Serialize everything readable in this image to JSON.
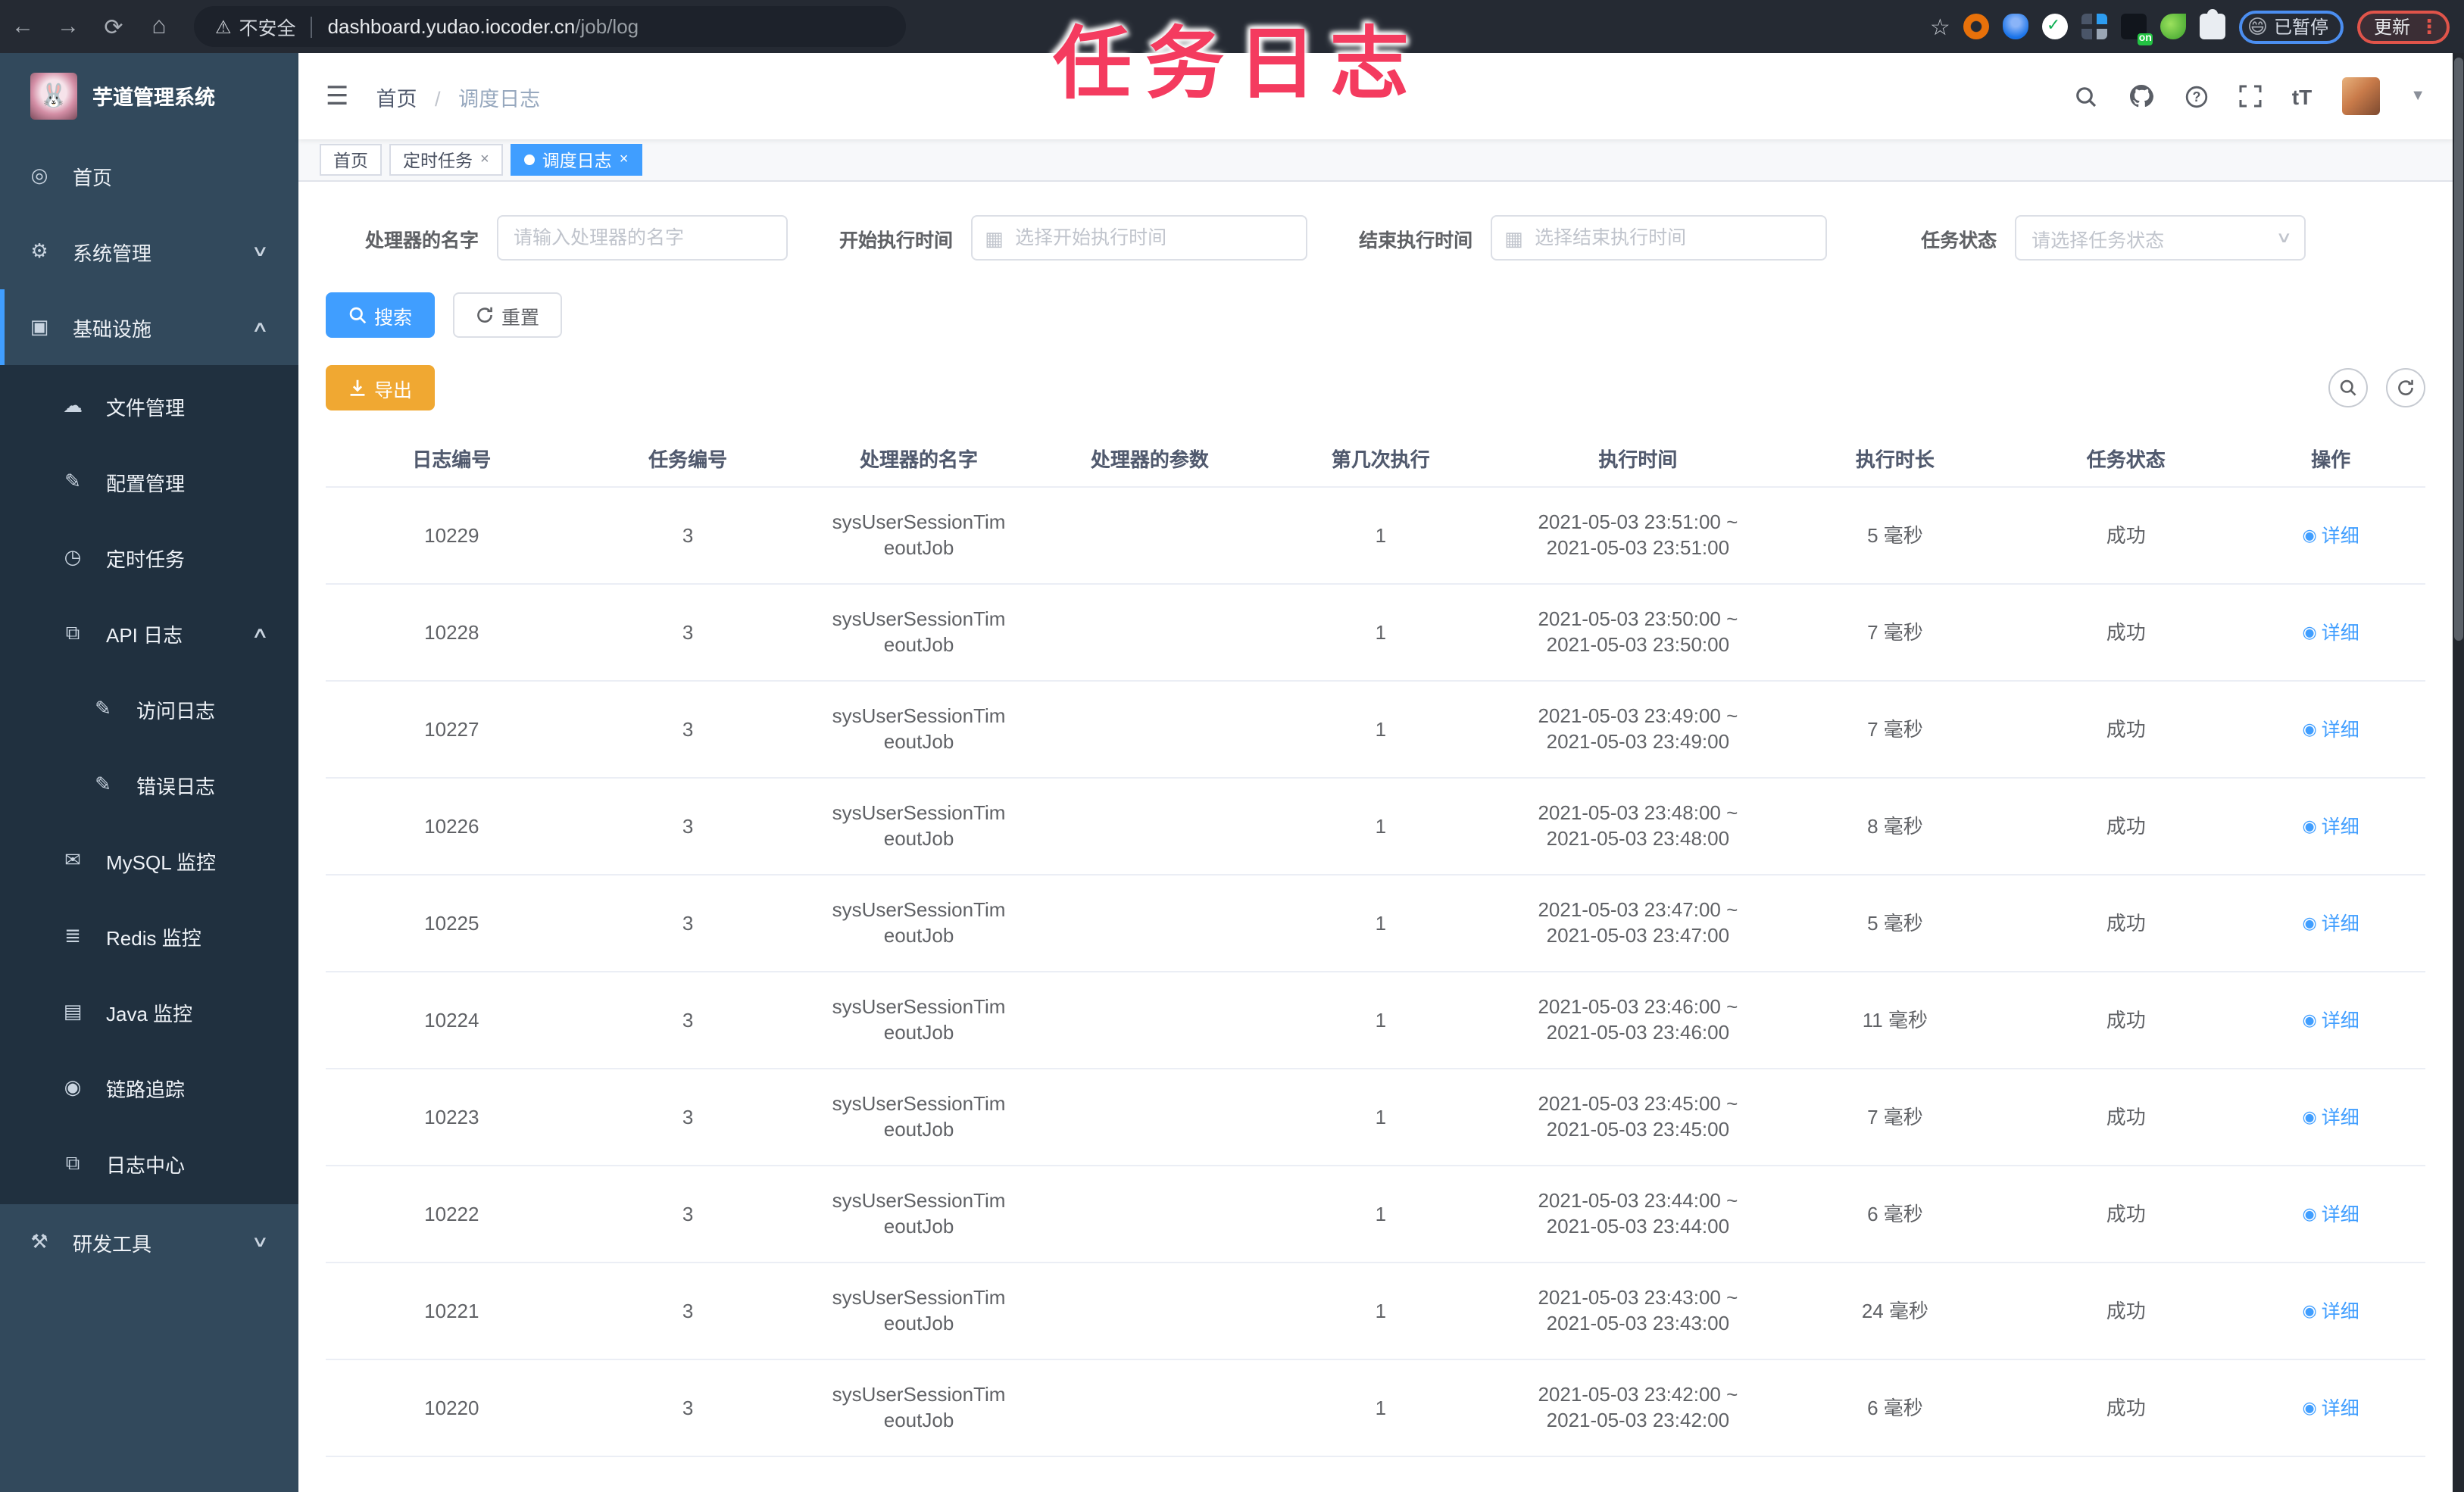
{
  "annotation": {
    "text": "任务日志"
  },
  "browser": {
    "not_secure": "不安全",
    "url_host": "dashboard.yudao.iocoder.cn",
    "url_path": "/job/log",
    "on_badge": "on",
    "paused_label": "已暂停",
    "paused_emoji": "😄",
    "update_label": "更新",
    "kebab": "⋮"
  },
  "sidebar": {
    "title": "芋道管理系统",
    "logo_emoji": "🐰",
    "items": [
      {
        "label": "首页"
      },
      {
        "label": "系统管理"
      },
      {
        "label": "基础设施"
      },
      {
        "label": "文件管理"
      },
      {
        "label": "配置管理"
      },
      {
        "label": "定时任务"
      },
      {
        "label": "API 日志"
      },
      {
        "label": "访问日志"
      },
      {
        "label": "错误日志"
      },
      {
        "label": "MySQL 监控"
      },
      {
        "label": "Redis 监控"
      },
      {
        "label": "Java 监控"
      },
      {
        "label": "链路追踪"
      },
      {
        "label": "日志中心"
      },
      {
        "label": "研发工具"
      }
    ]
  },
  "header": {
    "breadcrumb_home": "首页",
    "breadcrumb_sep": "/",
    "breadcrumb_current": "调度日志"
  },
  "tabs": [
    {
      "label": "首页"
    },
    {
      "label": "定时任务",
      "close": "×"
    },
    {
      "label": "调度日志",
      "close": "×"
    }
  ],
  "filters": {
    "handler_label": "处理器的名字",
    "handler_placeholder": "请输入处理器的名字",
    "begin_label": "开始执行时间",
    "begin_placeholder": "选择开始执行时间",
    "end_label": "结束执行时间",
    "end_placeholder": "选择结束执行时间",
    "status_label": "任务状态",
    "status_placeholder": "请选择任务状态"
  },
  "actions": {
    "search": "搜索",
    "reset": "重置",
    "export": "导出"
  },
  "table": {
    "headers": [
      "日志编号",
      "任务编号",
      "处理器的名字",
      "处理器的参数",
      "第几次执行",
      "执行时间",
      "执行时长",
      "任务状态",
      "操作"
    ],
    "action_label": "详细",
    "rows": [
      {
        "id": "10229",
        "job": "3",
        "handler1": "sysUserSessionTim",
        "handler2": "eoutJob",
        "param": "",
        "count": "1",
        "time1": "2021-05-03 23:51:00 ~",
        "time2": "2021-05-03 23:51:00",
        "duration": "5 毫秒",
        "status": "成功"
      },
      {
        "id": "10228",
        "job": "3",
        "handler1": "sysUserSessionTim",
        "handler2": "eoutJob",
        "param": "",
        "count": "1",
        "time1": "2021-05-03 23:50:00 ~",
        "time2": "2021-05-03 23:50:00",
        "duration": "7 毫秒",
        "status": "成功"
      },
      {
        "id": "10227",
        "job": "3",
        "handler1": "sysUserSessionTim",
        "handler2": "eoutJob",
        "param": "",
        "count": "1",
        "time1": "2021-05-03 23:49:00 ~",
        "time2": "2021-05-03 23:49:00",
        "duration": "7 毫秒",
        "status": "成功"
      },
      {
        "id": "10226",
        "job": "3",
        "handler1": "sysUserSessionTim",
        "handler2": "eoutJob",
        "param": "",
        "count": "1",
        "time1": "2021-05-03 23:48:00 ~",
        "time2": "2021-05-03 23:48:00",
        "duration": "8 毫秒",
        "status": "成功"
      },
      {
        "id": "10225",
        "job": "3",
        "handler1": "sysUserSessionTim",
        "handler2": "eoutJob",
        "param": "",
        "count": "1",
        "time1": "2021-05-03 23:47:00 ~",
        "time2": "2021-05-03 23:47:00",
        "duration": "5 毫秒",
        "status": "成功"
      },
      {
        "id": "10224",
        "job": "3",
        "handler1": "sysUserSessionTim",
        "handler2": "eoutJob",
        "param": "",
        "count": "1",
        "time1": "2021-05-03 23:46:00 ~",
        "time2": "2021-05-03 23:46:00",
        "duration": "11 毫秒",
        "status": "成功"
      },
      {
        "id": "10223",
        "job": "3",
        "handler1": "sysUserSessionTim",
        "handler2": "eoutJob",
        "param": "",
        "count": "1",
        "time1": "2021-05-03 23:45:00 ~",
        "time2": "2021-05-03 23:45:00",
        "duration": "7 毫秒",
        "status": "成功"
      },
      {
        "id": "10222",
        "job": "3",
        "handler1": "sysUserSessionTim",
        "handler2": "eoutJob",
        "param": "",
        "count": "1",
        "time1": "2021-05-03 23:44:00 ~",
        "time2": "2021-05-03 23:44:00",
        "duration": "6 毫秒",
        "status": "成功"
      },
      {
        "id": "10221",
        "job": "3",
        "handler1": "sysUserSessionTim",
        "handler2": "eoutJob",
        "param": "",
        "count": "1",
        "time1": "2021-05-03 23:43:00 ~",
        "time2": "2021-05-03 23:43:00",
        "duration": "24 毫秒",
        "status": "成功"
      },
      {
        "id": "10220",
        "job": "3",
        "handler1": "sysUserSessionTim",
        "handler2": "eoutJob",
        "param": "",
        "count": "1",
        "time1": "2021-05-03 23:42:00 ~",
        "time2": "2021-05-03 23:42:00",
        "duration": "6 毫秒",
        "status": "成功"
      }
    ]
  },
  "colors": {
    "primary": "#409eff",
    "warning": "#f0a832",
    "annotation": "#f43b5f",
    "sidebar_bg": "#32495c",
    "submenu_bg": "#20303f"
  }
}
